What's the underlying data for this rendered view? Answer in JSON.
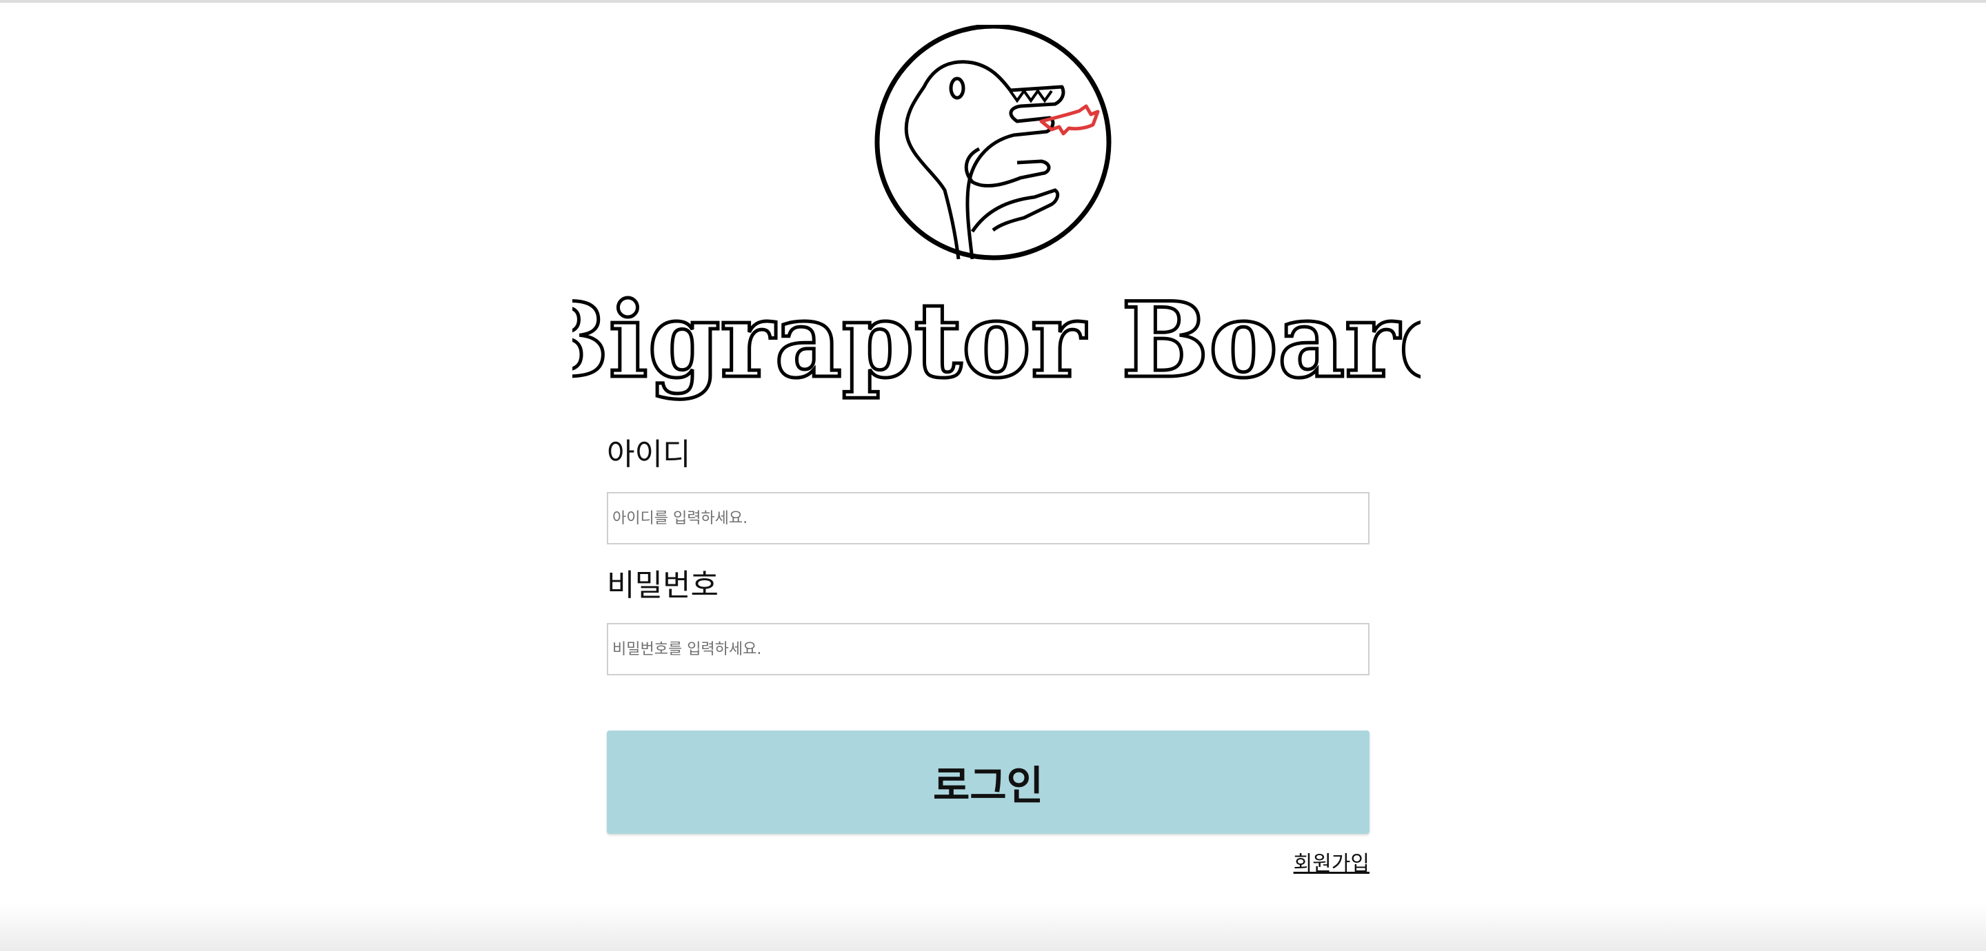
{
  "logo": {
    "icon": "raptor-logo-icon"
  },
  "brand": {
    "title": "Bigraptor Board"
  },
  "login_form": {
    "id_label": "아이디",
    "id_placeholder": "아이디를 입력하세요.",
    "password_label": "비밀번호",
    "password_placeholder": "비밀번호를 입력하세요.",
    "login_button": "로그인",
    "signup_link": "회원가입"
  },
  "colors": {
    "button_bg": "#acd6de",
    "logo_accent": "#e03a3a"
  }
}
